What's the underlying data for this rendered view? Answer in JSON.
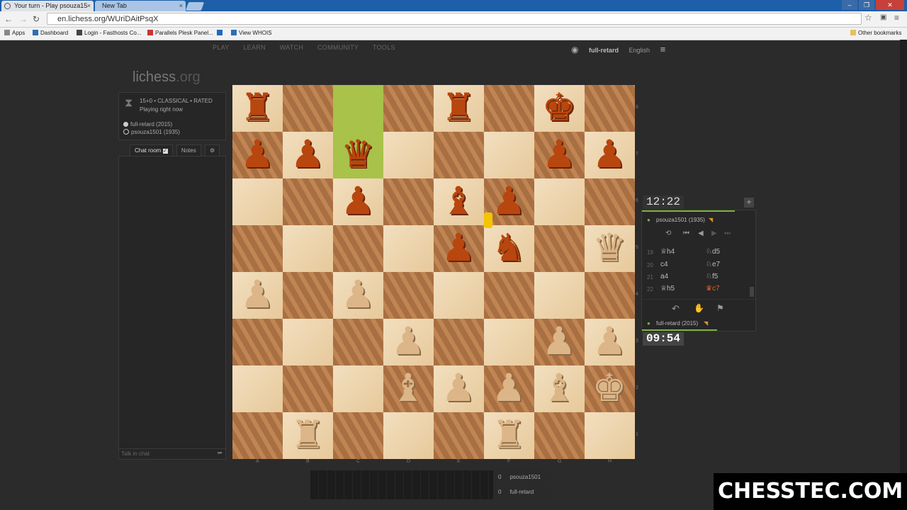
{
  "browser": {
    "tabs": [
      {
        "label": "Your turn - Play psouza15",
        "active": true
      },
      {
        "label": "New Tab",
        "active": false
      }
    ],
    "url": "en.lichess.org/WUriDAitPsqX",
    "bookmarks": [
      "Apps",
      "Dashboard",
      "Login - Fasthosts Co...",
      "Parallels Plesk Panel...",
      "View WHOIS"
    ],
    "other_bookmarks": "Other bookmarks"
  },
  "nav": {
    "items": [
      "PLAY",
      "LEARN",
      "WATCH",
      "COMMUNITY",
      "TOOLS"
    ],
    "username": "full-retard",
    "language": "English"
  },
  "logo": {
    "main": "lichess",
    "tld": ".org"
  },
  "game": {
    "mode": "15+0 • CLASSICAL • RATED",
    "status": "Playing right now",
    "players": [
      "full-retard (2015)",
      "psouza1501 (1935)"
    ]
  },
  "chat": {
    "tab_chat": "Chat room",
    "tab_notes": "Notes",
    "placeholder": "Talk in chat"
  },
  "board": {
    "files": [
      "A",
      "B",
      "C",
      "D",
      "E",
      "F",
      "G",
      "H"
    ],
    "ranks": [
      "8",
      "7",
      "6",
      "5",
      "4",
      "3",
      "2",
      "1"
    ]
  },
  "clocks": {
    "top": "12:22",
    "bottom": "09:54"
  },
  "panel": {
    "top_player": "psouza1501 (1935)",
    "bottom_player": "full-retard (2015)",
    "moves": [
      {
        "n": "19",
        "w": "♕h4",
        "b": "♘d5"
      },
      {
        "n": "20",
        "w": "c4",
        "b": "♘e7"
      },
      {
        "n": "21",
        "w": "a4",
        "b": "♘f5"
      },
      {
        "n": "22",
        "w": "♕h5",
        "b": "♛c7"
      }
    ],
    "accent": "#7fb13b",
    "last_move_color": "#e0602c"
  },
  "scores": [
    {
      "score": "0",
      "name": "psouza1501"
    },
    {
      "score": "0",
      "name": "full-retard"
    }
  ],
  "watermark": {
    "text": "CHESSTEC.COM"
  }
}
